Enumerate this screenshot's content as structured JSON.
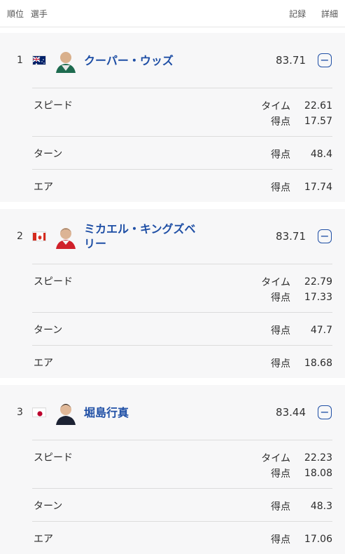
{
  "header": {
    "rank_label": "順位",
    "athlete_label": "選手",
    "record_label": "記録",
    "detail_label": "詳細"
  },
  "athletes": [
    {
      "rank": "1",
      "name": "クーパー・ウッズ",
      "score": "83.71",
      "speed_label": "スピード",
      "time_label": "タイム",
      "time": "22.61",
      "points_label": "得点",
      "speed_points": "17.57",
      "turn_label": "ターン",
      "turn_points": "48.4",
      "air_label": "エア",
      "air_points": "17.74",
      "flag": "australia",
      "toggle_icon": "minus-icon"
    },
    {
      "rank": "2",
      "name": "ミカエル・キングズベリー",
      "score": "83.71",
      "speed_label": "スピード",
      "time_label": "タイム",
      "time": "22.79",
      "points_label": "得点",
      "speed_points": "17.33",
      "turn_label": "ターン",
      "turn_points": "47.7",
      "air_label": "エア",
      "air_points": "18.68",
      "flag": "canada",
      "toggle_icon": "minus-icon"
    },
    {
      "rank": "3",
      "name": "堀島行真",
      "score": "83.44",
      "speed_label": "スピード",
      "time_label": "タイム",
      "time": "22.23",
      "points_label": "得点",
      "speed_points": "18.08",
      "turn_label": "ターン",
      "turn_points": "48.3",
      "air_label": "エア",
      "air_points": "17.06",
      "flag": "japan",
      "toggle_icon": "minus-icon"
    }
  ]
}
